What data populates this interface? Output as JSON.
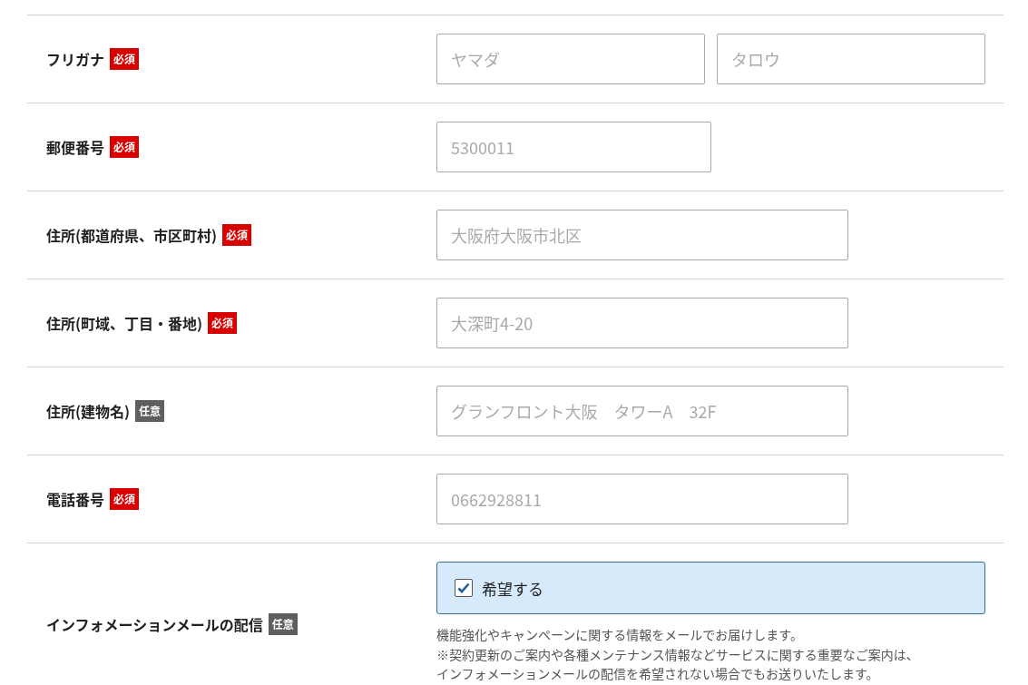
{
  "rows": [
    {
      "label": "フリガナ",
      "badge": {
        "text": "必須",
        "kind": "required"
      },
      "fields": [
        {
          "placeholder": "ヤマダ",
          "kind": "half"
        },
        {
          "placeholder": "タロウ",
          "kind": "half"
        }
      ]
    },
    {
      "label": "郵便番号",
      "badge": {
        "text": "必須",
        "kind": "required"
      },
      "fields": [
        {
          "placeholder": "5300011",
          "kind": "short"
        }
      ]
    },
    {
      "label": "住所(都道府県、市区町村)",
      "badge": {
        "text": "必須",
        "kind": "required"
      },
      "fields": [
        {
          "placeholder": "大阪府大阪市北区",
          "kind": "long"
        }
      ]
    },
    {
      "label": "住所(町域、丁目・番地)",
      "badge": {
        "text": "必須",
        "kind": "required"
      },
      "fields": [
        {
          "placeholder": "大深町4-20",
          "kind": "long"
        }
      ]
    },
    {
      "label": "住所(建物名)",
      "badge": {
        "text": "任意",
        "kind": "optional"
      },
      "fields": [
        {
          "placeholder": "グランフロント大阪　タワーA　32F",
          "kind": "long"
        }
      ]
    },
    {
      "label": "電話番号",
      "badge": {
        "text": "必須",
        "kind": "required"
      },
      "fields": [
        {
          "placeholder": "0662928811",
          "kind": "long"
        }
      ]
    }
  ],
  "newsletter": {
    "label": "インフォメーションメールの配信",
    "badge": {
      "text": "任意",
      "kind": "optional"
    },
    "option": {
      "label": "希望する",
      "checked": true
    },
    "notes": [
      "機能強化やキャンペーンに関する情報をメールでお届けします。",
      "※契約更新のご案内や各種メンテナンス情報などサービスに関する重要なご案内は、",
      "インフォメーションメールの配信を希望されない場合でもお送りいたします。"
    ]
  }
}
